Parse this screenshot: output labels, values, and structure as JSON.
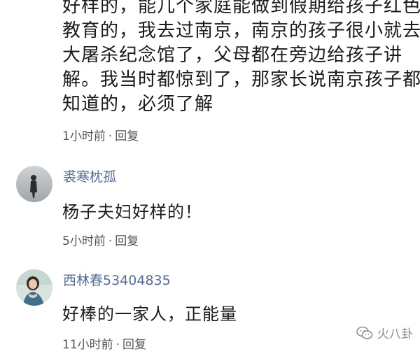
{
  "comments": [
    {
      "lines": [
        "好样的，能几个家庭能做到假期给孩子红色",
        "教育的，我去过南京，南京的孩子很小就去",
        "大屠杀纪念馆了，父母都在旁边给孩子讲",
        "解。我当时都惊到了，那家长说南京孩子都",
        "知道的，必须了解"
      ],
      "time": "1小时前",
      "sep": "·",
      "reply": "回复"
    },
    {
      "username": "裘寒枕孤",
      "text": "杨子夫妇好样的！",
      "time": "5小时前",
      "sep": "·",
      "reply": "回复"
    },
    {
      "username": "西林春53404835",
      "text": "好棒的一家人，正能量",
      "time": "11小时前",
      "sep": "·",
      "reply": "回复"
    }
  ],
  "watermark": {
    "text": "火八卦"
  },
  "colors": {
    "username": "#576b95",
    "meta": "#555555",
    "text": "#1b1b1b"
  }
}
